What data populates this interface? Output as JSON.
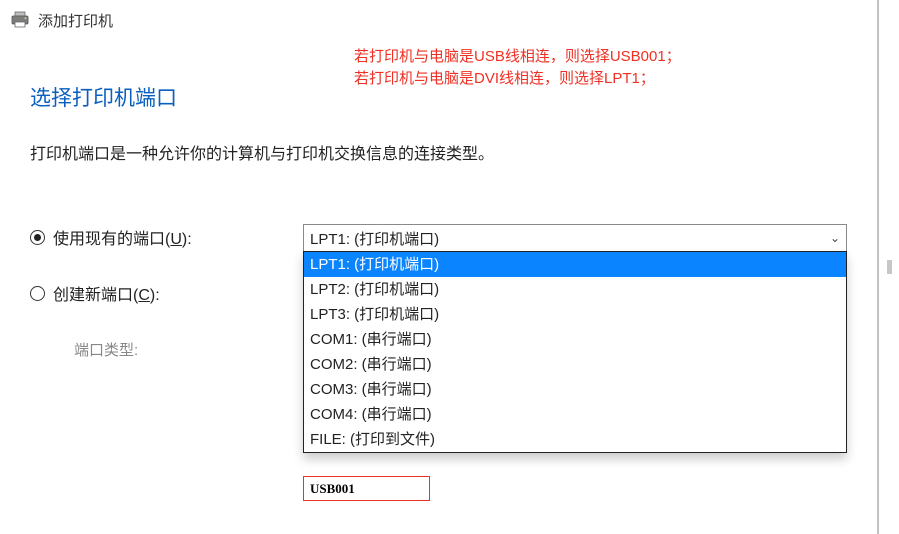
{
  "titlebar": {
    "title": "添加打印机"
  },
  "annotation": {
    "line1": "若打印机与电脑是USB线相连，则选择USB001；",
    "line2": "若打印机与电脑是DVI线相连，则选择LPT1；"
  },
  "page": {
    "title": "选择打印机端口",
    "description": "打印机端口是一种允许你的计算机与打印机交换信息的连接类型。"
  },
  "radios": {
    "use_existing_prefix": "使用现有的端口(",
    "use_existing_key": "U",
    "use_existing_suffix": "):",
    "create_new_prefix": "创建新端口(",
    "create_new_key": "C",
    "create_new_suffix": "):",
    "port_type_label": "端口类型:"
  },
  "select": {
    "current": "LPT1: (打印机端口)"
  },
  "options": [
    "LPT1: (打印机端口)",
    "LPT2: (打印机端口)",
    "LPT3: (打印机端口)",
    "COM1: (串行端口)",
    "COM2: (串行端口)",
    "COM3: (串行端口)",
    "COM4: (串行端口)",
    "FILE: (打印到文件)"
  ],
  "usb_callout": "USB001"
}
